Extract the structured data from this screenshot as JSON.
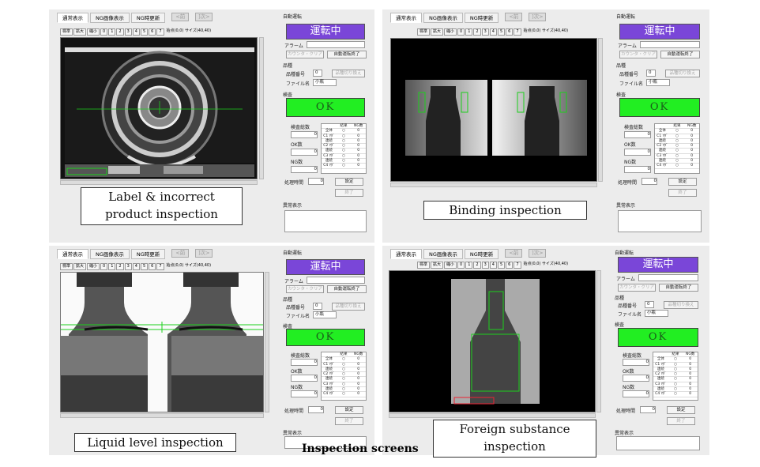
{
  "tabs": [
    "通常表示",
    "NG画像表示",
    "NG時更新"
  ],
  "nav": [
    "<前",
    "]次>"
  ],
  "toolbar": [
    "標準",
    "拡大",
    "縮小",
    "0",
    "1",
    "2",
    "3",
    "4",
    "5",
    "6",
    "7"
  ],
  "coord": "始点(0,0) サイズ(40,40)",
  "side": {
    "auto_run": "自動運転",
    "running": "運転中",
    "alarm": "アラーム",
    "counter_clear": "カウンタ・クリア",
    "auto_run_end": "自動運転終了",
    "product": "品種",
    "product_no": "品種番号",
    "product_no_val": "0",
    "product_switch": "品種切り換え",
    "file_name": "ファイル名",
    "file_name_val": "小瓶",
    "inspection": "検査",
    "ok": "OK",
    "total": "検査総数",
    "ok_count": "OK数",
    "ng_count": "NG数",
    "result_hdr": "結果",
    "ng_hdr": "NG数",
    "rows": [
      "全体",
      "C1 ﾏﾀﾞ",
      "連続",
      "C2 ﾏﾀﾞ",
      "連続",
      "C3 ﾏﾀﾞ",
      "連続",
      "C4 ﾏﾀﾞ",
      "連続"
    ],
    "zero": "0",
    "proc_time": "処理時間",
    "settings": "設定",
    "finish": "終了",
    "abnormal": "異常表示"
  },
  "captions": {
    "p1": "Label & incorrect\nproduct inspection",
    "p2": "Binding inspection",
    "p3": "Liquid level inspection",
    "p4": "Foreign substance\ninspection"
  },
  "footer": "Inspection screens",
  "colors": {
    "running": "#7a46d8",
    "ok": "#22ee22",
    "overlay": "#1cd01c"
  }
}
